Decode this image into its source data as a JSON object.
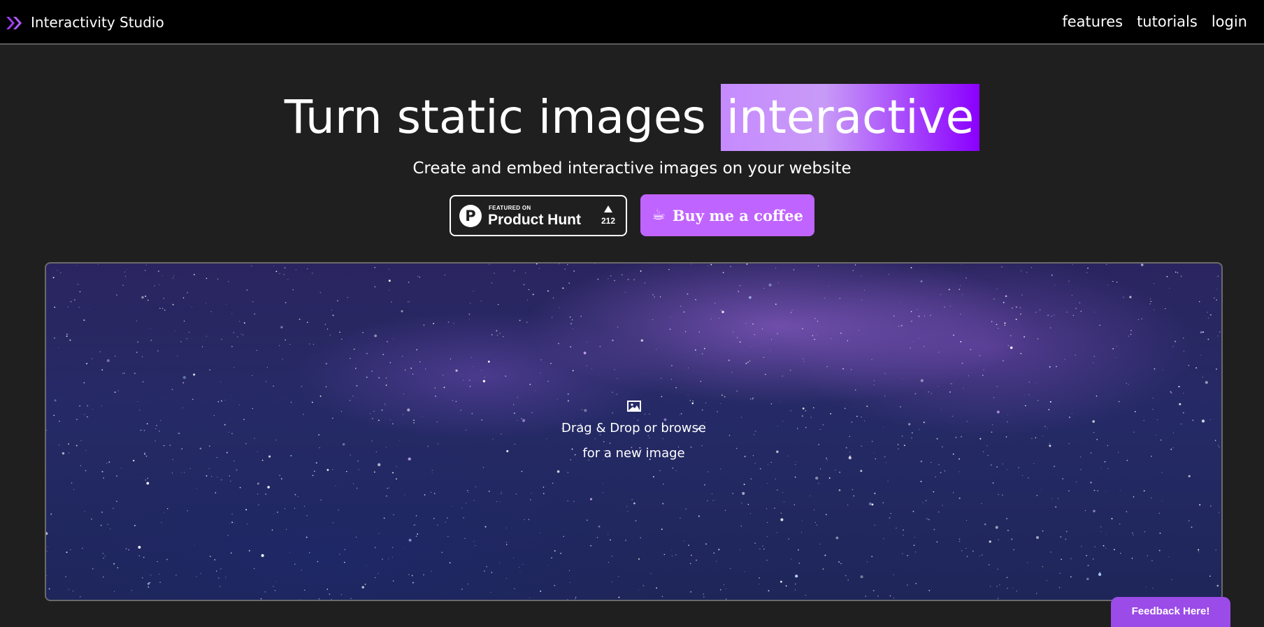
{
  "header": {
    "brand": "Interactivity Studio",
    "logo_icon": "chevrons-right-icon",
    "nav": [
      {
        "label": "features"
      },
      {
        "label": "tutorials"
      },
      {
        "label": "login"
      }
    ]
  },
  "hero": {
    "title_prefix": "Turn static images",
    "title_highlight": "interactive",
    "subtitle": "Create and embed interactive images on your website"
  },
  "product_hunt": {
    "featured_on": "FEATURED ON",
    "name": "Product Hunt",
    "logo_letter": "P",
    "upvotes": "212"
  },
  "coffee": {
    "icon": "☕",
    "label": "Buy me a coffee"
  },
  "dropzone": {
    "icon": "image-icon",
    "line1": "Drag & Drop or browse",
    "line2": "for a new image"
  },
  "feedback": {
    "label": "Feedback Here!"
  },
  "colors": {
    "accent": "#c064ff",
    "highlight_start": "#c68bff",
    "highlight_end": "#8a00ff",
    "feedback": "#9b4be8",
    "background": "#1f1f1f",
    "header": "#000000"
  }
}
